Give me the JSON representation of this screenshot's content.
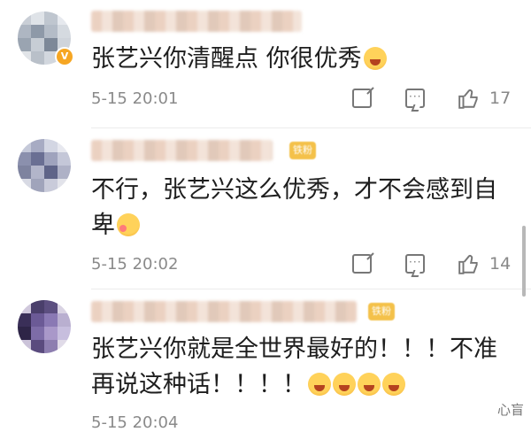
{
  "comments": [
    {
      "text": "张艺兴你清醒点 你很优秀",
      "timestamp": "5-15 20:01",
      "likes": "17",
      "verified_badge": "V"
    },
    {
      "text": "不行，张艺兴这么优秀，才不会感到自卑",
      "timestamp": "5-15 20:02",
      "likes": "14",
      "fan_badge": "铁粉"
    },
    {
      "text": "张艺兴你就是全世界最好的！！！不准再说这种话！！！！",
      "timestamp": "5-15 20:04",
      "fan_badge": "铁粉"
    }
  ],
  "watermark": "心盲",
  "colors": {
    "text": "#1e1e1e",
    "meta": "#8a8a8a",
    "fan_badge": "#f4c14a",
    "verified": "#f6a623"
  },
  "icons": [
    "share-icon",
    "comment-icon",
    "like-icon",
    "emoji-angry",
    "emoji-shy"
  ]
}
